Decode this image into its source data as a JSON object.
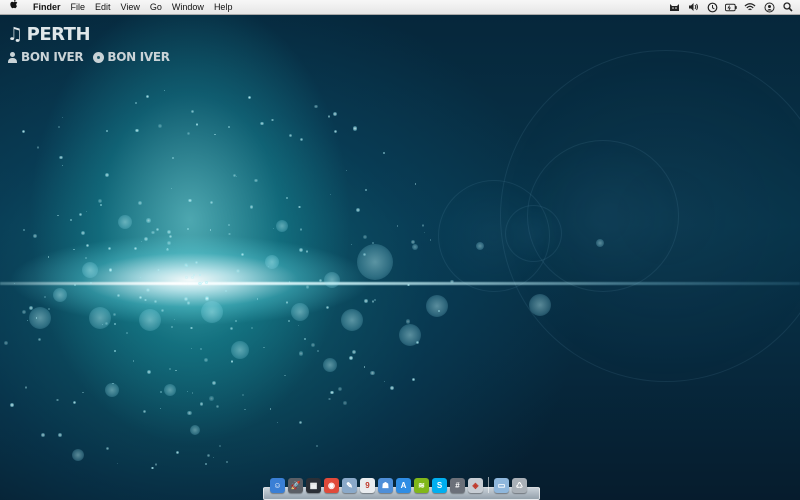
{
  "menubar": {
    "app_name": "Finder",
    "menus": [
      "File",
      "Edit",
      "View",
      "Go",
      "Window",
      "Help"
    ],
    "status_icons": [
      "cat-icon",
      "volume-icon",
      "time-machine-icon",
      "battery-icon",
      "wifi-icon",
      "user-icon",
      "spotlight-search-icon"
    ]
  },
  "now_playing": {
    "track": "PERTH",
    "artist": "BON IVER",
    "album": "BON IVER"
  },
  "dock": {
    "apps": [
      {
        "name": "finder-icon",
        "glyph": "☺",
        "color": "#3a7fd5"
      },
      {
        "name": "launchpad-icon",
        "glyph": "🚀",
        "color": "#5b5f66"
      },
      {
        "name": "mission-control-icon",
        "glyph": "▦",
        "color": "#2b2f36"
      },
      {
        "name": "chrome-icon",
        "glyph": "◉",
        "color": "#e04a3a"
      },
      {
        "name": "photos-icon",
        "glyph": "✎",
        "color": "#8aa9c9"
      },
      {
        "name": "calendar-icon",
        "glyph": "9",
        "color": "#e9ecef"
      },
      {
        "name": "contacts-icon",
        "glyph": "☗",
        "color": "#4f8fd8"
      },
      {
        "name": "app-store-icon",
        "glyph": "A",
        "color": "#2f8de4"
      },
      {
        "name": "spotify-icon",
        "glyph": "≋",
        "color": "#81b71a"
      },
      {
        "name": "skype-icon",
        "glyph": "S",
        "color": "#00aff0"
      },
      {
        "name": "calculator-icon",
        "glyph": "#",
        "color": "#6b7079"
      },
      {
        "name": "preview-icon",
        "glyph": "◈",
        "color": "#c7cdd4"
      }
    ],
    "right": [
      {
        "name": "downloads-folder-icon",
        "glyph": "▭",
        "color": "#8fb7dc"
      },
      {
        "name": "trash-icon",
        "glyph": "♺",
        "color": "#a9b0b7"
      }
    ]
  }
}
